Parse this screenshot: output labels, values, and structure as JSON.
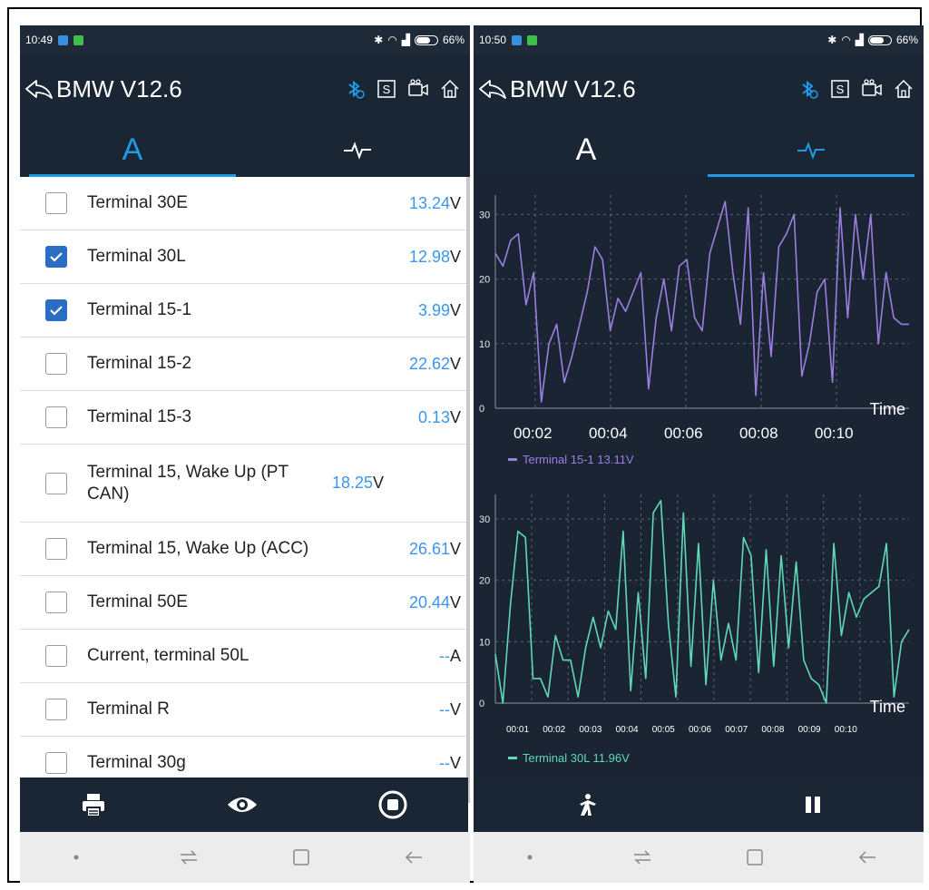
{
  "left": {
    "status_time": "10:49",
    "battery": "66%",
    "title": "BMW V12.6",
    "tab_a": "A",
    "rows": [
      {
        "label": "Terminal 30E",
        "value": "13.24",
        "unit": "V",
        "checked": false,
        "tall": false
      },
      {
        "label": "Terminal 30L",
        "value": "12.98",
        "unit": "V",
        "checked": true,
        "tall": false
      },
      {
        "label": "Terminal 15-1",
        "value": "3.99",
        "unit": "V",
        "checked": true,
        "tall": false
      },
      {
        "label": "Terminal 15-2",
        "value": "22.62",
        "unit": "V",
        "checked": false,
        "tall": false
      },
      {
        "label": "Terminal 15-3",
        "value": "0.13",
        "unit": "V",
        "checked": false,
        "tall": false
      },
      {
        "label": "Terminal 15, Wake Up (PT CAN)",
        "value": "18.25",
        "unit": "V",
        "checked": false,
        "tall": true
      },
      {
        "label": "Terminal 15, Wake Up (ACC)",
        "value": "26.61",
        "unit": "V",
        "checked": false,
        "tall": false
      },
      {
        "label": "Terminal 50E",
        "value": "20.44",
        "unit": "V",
        "checked": false,
        "tall": false
      },
      {
        "label": "Current, terminal 50L",
        "value": "--",
        "unit": "A",
        "checked": false,
        "tall": false
      },
      {
        "label": "Terminal R",
        "value": "--",
        "unit": "V",
        "checked": false,
        "tall": false
      },
      {
        "label": "Terminal 30g",
        "value": "--",
        "unit": "V",
        "checked": false,
        "tall": false
      }
    ]
  },
  "right": {
    "status_time": "10:50",
    "battery": "66%",
    "title": "BMW V12.6",
    "tab_a": "A"
  },
  "colors": {
    "header_bg": "#1b2635",
    "accent": "#1e9be8",
    "value_blue": "#3b96f0",
    "series_purple": "#9b7fe0",
    "series_teal": "#5fd9b8"
  },
  "chart_data": [
    {
      "type": "line",
      "x": [
        "00:02",
        "00:04",
        "00:06",
        "00:08",
        "00:10"
      ],
      "xlabel": "Time",
      "yticks": [
        0,
        10,
        20,
        30
      ],
      "ylim": [
        0,
        33
      ],
      "grid": true,
      "legend": "bottom-left",
      "series": [
        {
          "name": "Terminal 15-1",
          "legend_value": "13.11V",
          "color": "#9b7fe0",
          "values": [
            24,
            22,
            26,
            27,
            16,
            21,
            1,
            10,
            13,
            4,
            8,
            13,
            18,
            25,
            23,
            12,
            17,
            15,
            18,
            21,
            3,
            14,
            20,
            12,
            22,
            23,
            14,
            12,
            24,
            28,
            32,
            21,
            13,
            31,
            2,
            21,
            8,
            25,
            27,
            30,
            5,
            10,
            18,
            20,
            4,
            31,
            14,
            30,
            20,
            30,
            10,
            21,
            14,
            13,
            13
          ]
        }
      ]
    },
    {
      "type": "line",
      "x": [
        "00:01",
        "00:02",
        "00:03",
        "00:04",
        "00:05",
        "00:06",
        "00:07",
        "00:08",
        "00:09",
        "00:10"
      ],
      "xlabel": "Time",
      "yticks": [
        0,
        10,
        20,
        30
      ],
      "ylim": [
        0,
        34
      ],
      "grid": true,
      "legend": "bottom-left",
      "series": [
        {
          "name": "Terminal 30L",
          "legend_value": "11.96V",
          "color": "#5fd9b8",
          "values": [
            8,
            0,
            16,
            28,
            27,
            4,
            4,
            1,
            11,
            7,
            7,
            1,
            9,
            14,
            9,
            15,
            12,
            28,
            2,
            18,
            4,
            31,
            33,
            13,
            1,
            31,
            6,
            26,
            3,
            20,
            7,
            13,
            7,
            27,
            24,
            5,
            25,
            6,
            24,
            9,
            23,
            7,
            4,
            3,
            0,
            26,
            11,
            18,
            14,
            17,
            18,
            19,
            26,
            1,
            10,
            12
          ]
        }
      ]
    }
  ]
}
